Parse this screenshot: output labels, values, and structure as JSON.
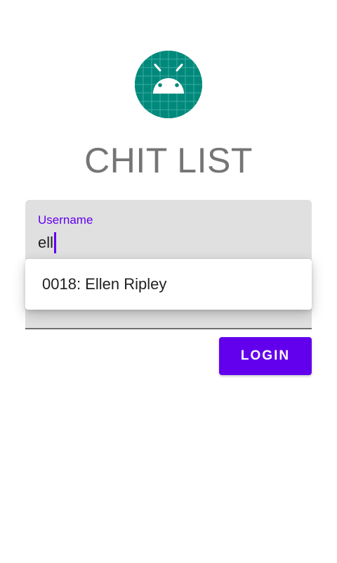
{
  "app": {
    "title": "CHIT LIST",
    "logo_icon": "android-icon"
  },
  "login_form": {
    "username": {
      "label": "Username",
      "value": "ell"
    },
    "autocomplete": {
      "suggestions": [
        {
          "label": "0018: Ellen Ripley"
        }
      ]
    },
    "login_button_label": "LOGIN"
  },
  "colors": {
    "accent": "#6200ee",
    "logo_background": "#00897b",
    "title_text": "#757575",
    "field_background": "#e0e0e0"
  }
}
